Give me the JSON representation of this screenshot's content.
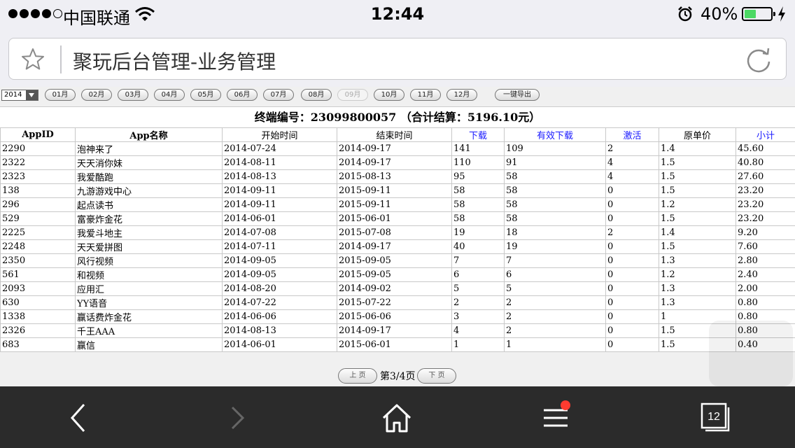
{
  "status_bar": {
    "carrier": "中国联通",
    "time": "12:44",
    "battery_percent": "40%",
    "battery_level": 0.4,
    "signal_bars": 4,
    "signal_total": 5
  },
  "browser": {
    "page_title": "聚玩后台管理-业务管理",
    "tabs_count": "12"
  },
  "month_bar": {
    "year": "2014",
    "months": [
      "01月",
      "02月",
      "03月",
      "04月",
      "05月",
      "06月",
      "07月",
      "08月",
      "09月",
      "10月",
      "11月",
      "12月"
    ],
    "disabled_month": "09月",
    "export_label": "一键导出"
  },
  "report": {
    "caption": "终端编号：23099800057 （合计结算：5196.10元）",
    "columns": [
      "AppID",
      "App名称",
      "开始时间",
      "结束时间",
      "下载",
      "有效下载",
      "激活",
      "原单价",
      "小计"
    ],
    "rows": [
      [
        "2290",
        "泡神来了",
        "2014-07-24",
        "2014-09-17",
        "141",
        "109",
        "2",
        "1.4",
        "45.60"
      ],
      [
        "2322",
        "天天消你妹",
        "2014-08-11",
        "2014-09-17",
        "110",
        "91",
        "4",
        "1.5",
        "40.80"
      ],
      [
        "2323",
        "我爱酷跑",
        "2014-08-13",
        "2015-08-13",
        "95",
        "58",
        "4",
        "1.5",
        "27.60"
      ],
      [
        "138",
        "九游游戏中心",
        "2014-09-11",
        "2015-09-11",
        "58",
        "58",
        "0",
        "1.5",
        "23.20"
      ],
      [
        "296",
        "起点读书",
        "2014-09-11",
        "2015-09-11",
        "58",
        "58",
        "0",
        "1.2",
        "23.20"
      ],
      [
        "529",
        "富豪炸金花",
        "2014-06-01",
        "2015-06-01",
        "58",
        "58",
        "0",
        "1.5",
        "23.20"
      ],
      [
        "2225",
        "我爱斗地主",
        "2014-07-08",
        "2015-07-08",
        "19",
        "18",
        "2",
        "1.4",
        "9.20"
      ],
      [
        "2248",
        "天天爱拼图",
        "2014-07-11",
        "2014-09-17",
        "40",
        "19",
        "0",
        "1.5",
        "7.60"
      ],
      [
        "2350",
        "风行视频",
        "2014-09-05",
        "2015-09-05",
        "7",
        "7",
        "0",
        "1.3",
        "2.80"
      ],
      [
        "561",
        "和视频",
        "2014-09-05",
        "2015-09-05",
        "6",
        "6",
        "0",
        "1.2",
        "2.40"
      ],
      [
        "2093",
        "应用汇",
        "2014-08-20",
        "2014-09-02",
        "5",
        "5",
        "0",
        "1.3",
        "2.00"
      ],
      [
        "630",
        "YY语音",
        "2014-07-22",
        "2015-07-22",
        "2",
        "2",
        "0",
        "1.3",
        "0.80"
      ],
      [
        "1338",
        "赢话费炸金花",
        "2014-06-06",
        "2015-06-06",
        "3",
        "2",
        "0",
        "1",
        "0.80"
      ],
      [
        "2326",
        "千王AAA",
        "2014-08-13",
        "2014-09-17",
        "4",
        "2",
        "0",
        "1.5",
        "0.80"
      ],
      [
        "683",
        "赢信",
        "2014-06-01",
        "2015-06-01",
        "1",
        "1",
        "0",
        "1.5",
        "0.40"
      ]
    ]
  },
  "pager": {
    "prev_label": "上 页",
    "indicator": "第3/4页",
    "next_label": "下 页"
  },
  "colors": {
    "link_header": "#1a1aff",
    "toolbar_bg": "#2b2b2b",
    "badge": "#ff3b30",
    "battery_fill": "#4cd964"
  }
}
